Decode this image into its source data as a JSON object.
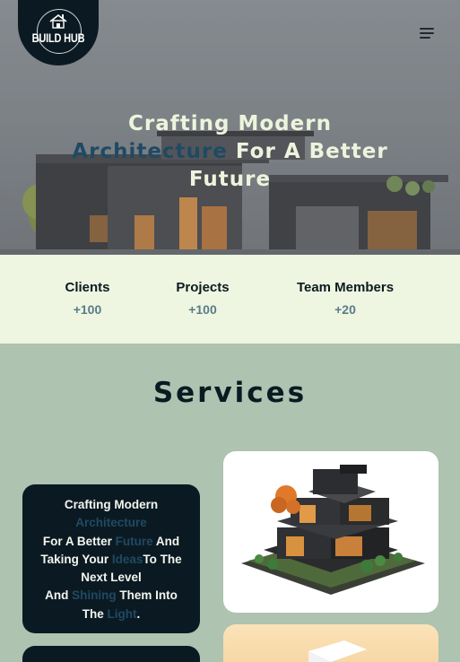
{
  "brand": {
    "logo_text": "BUILD HUB"
  },
  "hero": {
    "title_part1": "Crafting Modern",
    "title_highlight": "Architecture",
    "title_part2": "For A Better",
    "title_part3": "Future"
  },
  "stats": [
    {
      "label": "Clients",
      "value": "+100"
    },
    {
      "label": "Projects",
      "value": "+100"
    },
    {
      "label": "Team Members",
      "value": "+20"
    }
  ],
  "services": {
    "title": "Services",
    "card": {
      "line1": "Crafting Modern",
      "line2_hl": "Architecture",
      "line3_a": "For A Better ",
      "line3_hl": "Future",
      "line3_b": " And",
      "line4_a": "Taking Your ",
      "line4_hl": "Ideas",
      "line4_b": "To The",
      "line5": "Next Level",
      "line6_a": "And ",
      "line6_hl": "Shining",
      "line6_b": " Them Into",
      "line7_a": "The ",
      "line7_hl": "Light",
      "line7_b": "."
    }
  },
  "colors": {
    "page_bg": "#aec3b0",
    "stats_bg": "#eef5e0",
    "dark": "#0b1a22",
    "accent": "#1f4a63",
    "hero_text": "#eef4dc"
  },
  "icons": {
    "menu": "hamburger-menu-icon",
    "logo": "house-icon"
  }
}
